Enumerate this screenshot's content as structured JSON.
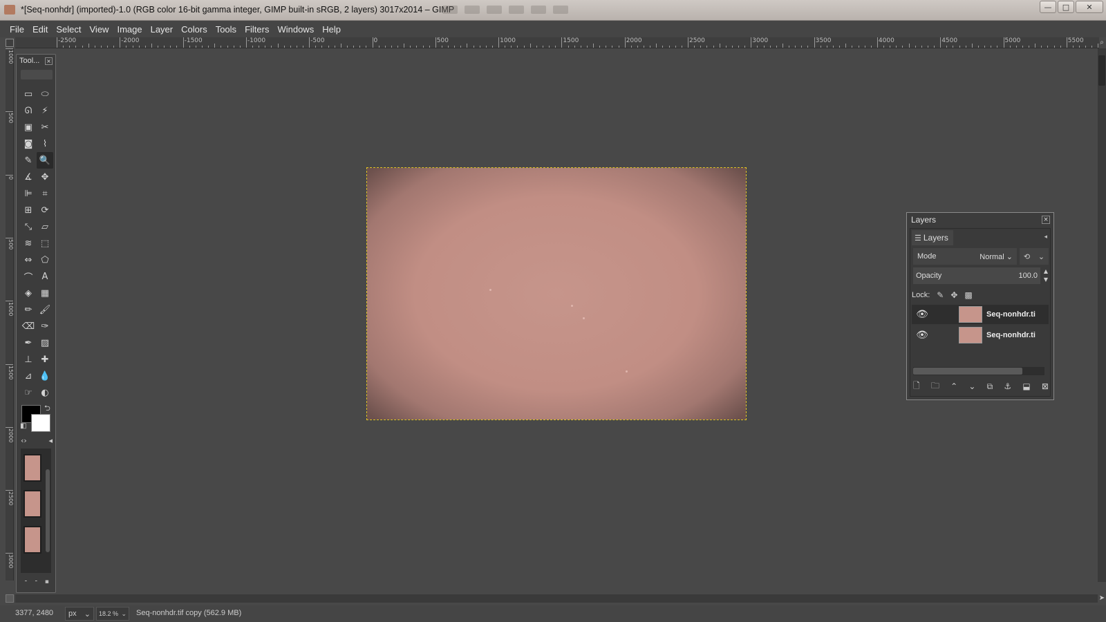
{
  "window": {
    "title": "*[Seq-nonhdr] (imported)-1.0 (RGB color 16-bit gamma integer, GIMP built-in sRGB, 2 layers) 3017x2014 – GIMP",
    "minimize": "—",
    "maximize": "□",
    "close": "✕"
  },
  "menubar": [
    "File",
    "Edit",
    "Select",
    "View",
    "Image",
    "Layer",
    "Colors",
    "Tools",
    "Filters",
    "Windows",
    "Help"
  ],
  "ruler_top_labels": [
    "-2500",
    "-2000",
    "-1500",
    "-1000",
    "-500",
    "0",
    "500",
    "1000",
    "1500",
    "2000",
    "2500",
    "3000",
    "3500",
    "4000",
    "4500",
    "5000",
    "5500"
  ],
  "ruler_left_labels": [
    "1000",
    "500",
    "0",
    "500",
    "1000",
    "1500",
    "2000",
    "2500",
    "3000"
  ],
  "toolbox": {
    "title": "Tool...",
    "close": "×",
    "tools": [
      {
        "icon": "rect-select-icon",
        "glyph": "▭"
      },
      {
        "icon": "ellipse-select-icon",
        "glyph": "⬭"
      },
      {
        "icon": "free-select-icon",
        "glyph": "ᘏ"
      },
      {
        "icon": "fuzzy-select-icon",
        "glyph": "⚡"
      },
      {
        "icon": "select-by-color-icon",
        "glyph": "▣"
      },
      {
        "icon": "scissors-select-icon",
        "glyph": "✂"
      },
      {
        "icon": "foreground-select-icon",
        "glyph": "◙"
      },
      {
        "icon": "paths-icon",
        "glyph": "⌇"
      },
      {
        "icon": "color-picker-icon",
        "glyph": "✎"
      },
      {
        "icon": "zoom-icon",
        "glyph": "🔍",
        "active": true
      },
      {
        "icon": "measure-icon",
        "glyph": "∡"
      },
      {
        "icon": "move-icon",
        "glyph": "✥"
      },
      {
        "icon": "align-icon",
        "glyph": "⊫"
      },
      {
        "icon": "crop-icon",
        "glyph": "⌗"
      },
      {
        "icon": "unified-transform-icon",
        "glyph": "⊞"
      },
      {
        "icon": "rotate-icon",
        "glyph": "⟳"
      },
      {
        "icon": "scale-icon",
        "glyph": "⤡"
      },
      {
        "icon": "shear-icon",
        "glyph": "▱"
      },
      {
        "icon": "warp-transform-icon",
        "glyph": "≋"
      },
      {
        "icon": "perspective-icon",
        "glyph": "⬚"
      },
      {
        "icon": "flip-icon",
        "glyph": "⇔"
      },
      {
        "icon": "cage-transform-icon",
        "glyph": "⬠"
      },
      {
        "icon": "text-warp-icon",
        "glyph": "⌒"
      },
      {
        "icon": "text-icon",
        "glyph": "A"
      },
      {
        "icon": "bucket-fill-icon",
        "glyph": "◈"
      },
      {
        "icon": "gradient-icon",
        "glyph": "▦"
      },
      {
        "icon": "pencil-icon",
        "glyph": "✏"
      },
      {
        "icon": "paintbrush-icon",
        "glyph": "🖌"
      },
      {
        "icon": "eraser-icon",
        "glyph": "⌫"
      },
      {
        "icon": "airbrush-icon",
        "glyph": "✑"
      },
      {
        "icon": "ink-icon",
        "glyph": "✒"
      },
      {
        "icon": "mypaint-brush-icon",
        "glyph": "▨"
      },
      {
        "icon": "clone-icon",
        "glyph": "⊥"
      },
      {
        "icon": "heal-icon",
        "glyph": "✚"
      },
      {
        "icon": "perspective-clone-icon",
        "glyph": "⊿"
      },
      {
        "icon": "blur-icon",
        "glyph": "💧"
      },
      {
        "icon": "smudge-icon",
        "glyph": "☞"
      },
      {
        "icon": "dodge-burn-icon",
        "glyph": "◐"
      }
    ],
    "swap_glyph": "⮌",
    "reset_glyph": "◧",
    "nav_left": "‹›",
    "nav_right": "◂",
    "bottom_glyphs": [
      "⁃",
      "⁃",
      "▪"
    ]
  },
  "layers_dialog": {
    "title": "Layers",
    "close": "×",
    "tab_label": "Layers",
    "tab_icon": "☰",
    "menu_arrow": "◂",
    "mode_label": "Mode",
    "mode_value": "Normal",
    "mode_arrow": "⌄",
    "composite_icon": "⟲",
    "opacity_label": "Opacity",
    "opacity_value": "100.0",
    "lock_label": "Lock:",
    "lock_icons": [
      "✎",
      "✥",
      "▩"
    ],
    "layers": [
      {
        "name": "Seq-nonhdr.ti",
        "visible_glyph": "👁",
        "selected": true
      },
      {
        "name": "Seq-nonhdr.ti",
        "visible_glyph": "👁",
        "selected": false
      }
    ],
    "buttons": [
      "🗋",
      "🗀",
      "⌃",
      "⌄",
      "⧉",
      "⚓",
      "⬓",
      "⊠"
    ]
  },
  "statusbar": {
    "coords": "3377, 2480",
    "unit": "px",
    "zoom": "18.2 %",
    "message": "Seq-nonhdr.tif copy (562.9 MB)"
  },
  "colors": {
    "canvas_bg": "#484848",
    "image_center": "#c6958b",
    "image_edge": "#6d514d",
    "selection_marching_ants": "#e1c323",
    "foreground": "#000000",
    "background": "#ffffff"
  }
}
